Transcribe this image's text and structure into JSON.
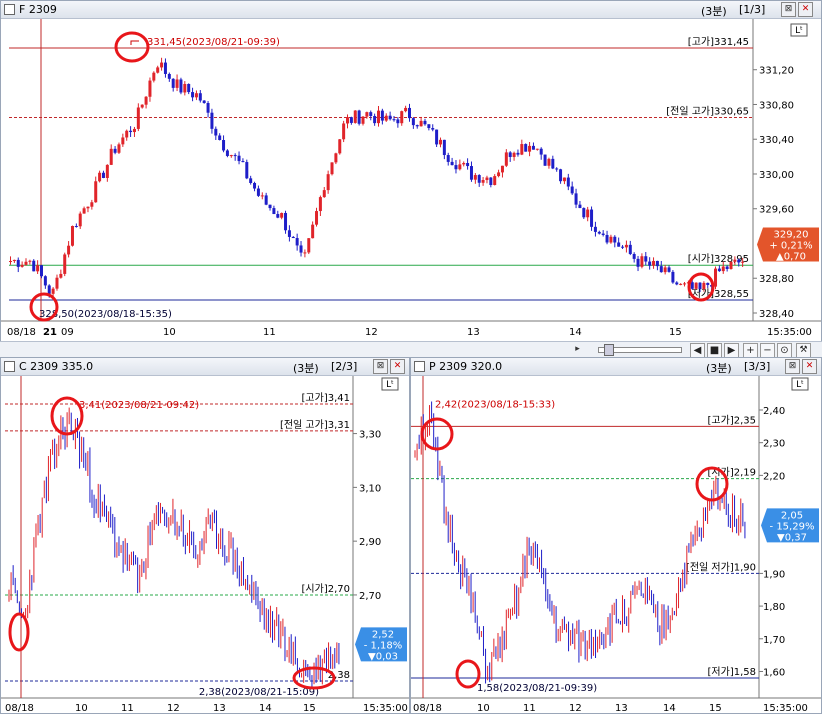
{
  "panels": {
    "top": {
      "title": "F 2309",
      "period": "(3분)",
      "page": "[1/3]",
      "axis_labels": [
        "331,20",
        "330,80",
        "330,40",
        "330,00",
        "329,60",
        "328,80",
        "328,40"
      ],
      "time_labels": [
        "08/18",
        "21",
        "09",
        "10",
        "11",
        "12",
        "13",
        "14",
        "15",
        "15:35:00"
      ],
      "ref_labels": {
        "high": "[고가]331,45",
        "prev_high": "[전일 고가]330,65",
        "open": "[시가]328,95",
        "low": "[저가]328,55"
      },
      "annotations": {
        "high": "331,45(2023/08/21-09:39)",
        "low": "328,50(2023/08/18-15:35)"
      },
      "badge": {
        "price": "329,20",
        "pct": "+ 0,21%",
        "chg": "▲0,70"
      }
    },
    "left": {
      "title": "C 2309 335.0",
      "period": "(3분)",
      "page": "[2/3]",
      "axis_labels": [
        "3,30",
        "3,10",
        "2,90",
        "2,70"
      ],
      "time_labels": [
        "08/18",
        "10",
        "11",
        "12",
        "13",
        "14",
        "15",
        "15:35:00"
      ],
      "ref_labels": {
        "high": "[고가]3,41",
        "prev_high": "[전일 고가]3,31",
        "open": "[시가]2,70",
        "low": "2,38"
      },
      "annotations": {
        "high": "3,41(2023/08/21-09:42)",
        "low": "2,38(2023/08/21-15:09)"
      },
      "badge": {
        "price": "2,52",
        "pct": "- 1,18%",
        "chg": "▼0,03"
      }
    },
    "right": {
      "title": "P 2309 320.0",
      "period": "(3분)",
      "page": "[3/3]",
      "axis_labels": [
        "2,40",
        "2,30",
        "2,20",
        "1,90",
        "1,80",
        "1,70",
        "1,60"
      ],
      "time_labels": [
        "08/18",
        "10",
        "11",
        "12",
        "13",
        "14",
        "15",
        "15:35:00"
      ],
      "ref_labels": {
        "high": "[고가]2,35",
        "open": "[시가]2,19",
        "prev_low": "[전일 저가]1,90",
        "low": "[저가]1,58"
      },
      "annotations": {
        "high": "2,42(2023/08/18-15:33)",
        "low": "1,58(2023/08/21-09:39)"
      },
      "badge": {
        "price": "2,05",
        "pct": "- 15,29%",
        "chg": "▼0,37"
      }
    }
  },
  "toolbar": {
    "plus": "+",
    "minus": "−",
    "reset": "⊙",
    "wrench": "🔧"
  },
  "colors": {
    "up": "#e0242a",
    "down": "#1e1ec8",
    "highline": "#c0282a",
    "lowline": "#1e2a9a",
    "openline": "#2aa84a",
    "badge_up": "#e3552b",
    "badge_down": "#3a8fe6",
    "circle": "#e8161a"
  }
}
